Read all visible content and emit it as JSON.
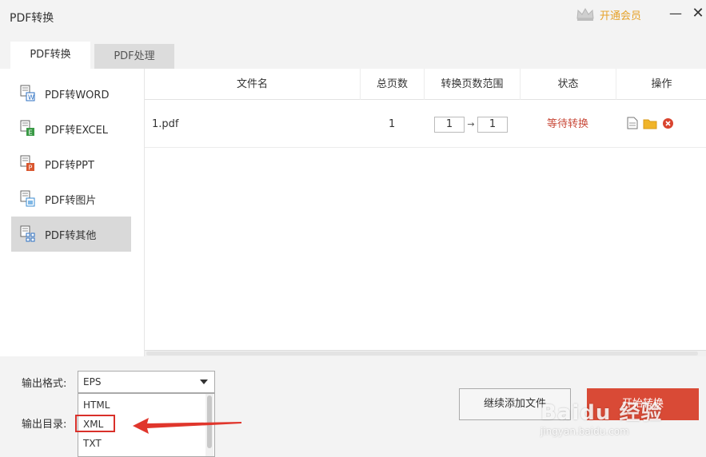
{
  "window": {
    "title": "PDF转换",
    "vip_label": "开通会员",
    "minimize": "—",
    "close": "✕"
  },
  "tabs": [
    {
      "label": "PDF转换",
      "active": true
    },
    {
      "label": "PDF处理",
      "active": false
    }
  ],
  "sidebar": {
    "items": [
      {
        "label": "PDF转WORD",
        "icon": "word-doc-icon",
        "color": "#2b6fc2",
        "letter": "W"
      },
      {
        "label": "PDF转EXCEL",
        "icon": "excel-doc-icon",
        "color": "#3a9a46",
        "letter": "E"
      },
      {
        "label": "PDF转PPT",
        "icon": "ppt-doc-icon",
        "color": "#d9572f",
        "letter": "P"
      },
      {
        "label": "PDF转图片",
        "icon": "image-doc-icon",
        "color": "#3a8bd0",
        "letter": ""
      },
      {
        "label": "PDF转其他",
        "icon": "other-doc-icon",
        "color": "#2b6fc2",
        "letter": "",
        "active": true
      }
    ]
  },
  "table": {
    "headers": [
      "文件名",
      "总页数",
      "转换页数范围",
      "状态",
      "操作"
    ],
    "rows": [
      {
        "filename": "1.pdf",
        "pages": "1",
        "range_from": "1",
        "range_to": "1",
        "status": "等待转换"
      }
    ]
  },
  "bottom": {
    "format_label": "输出格式:",
    "format_value": "EPS",
    "format_options": [
      "HTML",
      "XML",
      "TXT"
    ],
    "dir_label": "输出目录:",
    "add_button": "继续添加文件",
    "start_button": "开始转换"
  },
  "watermark": {
    "main": "Baidu 经验",
    "sub": "jingyan.baidu.com"
  },
  "colors": {
    "accent": "#d94a36",
    "vip": "#e6a22a",
    "status": "#c94a3a"
  }
}
